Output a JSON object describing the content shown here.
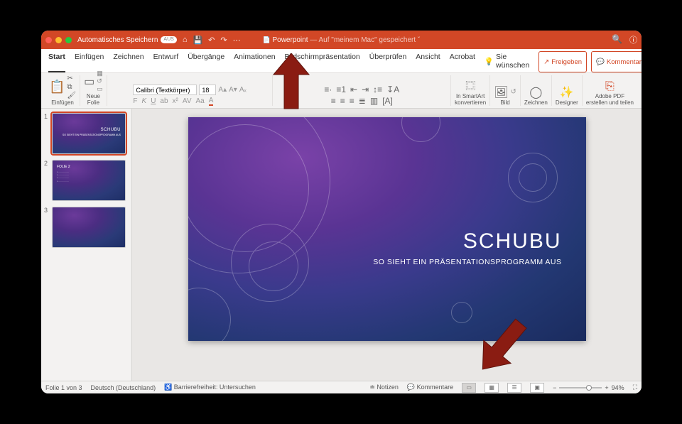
{
  "titlebar": {
    "autosave_label": "Automatisches Speichern",
    "autosave_state": "AUS",
    "filename": "Powerpoint",
    "saved_suffix": " — Auf \"meinem Mac\" gespeichert",
    "chevron": "ˇ"
  },
  "tabs": {
    "items": [
      "Start",
      "Einfügen",
      "Zeichnen",
      "Entwurf",
      "Übergänge",
      "Animationen",
      "Bildschirmpräsentation",
      "Überprüfen",
      "Ansicht",
      "Acrobat"
    ],
    "tellme": "Sie wünschen",
    "share": "Freigeben",
    "comments": "Kommentare",
    "active_index": 0
  },
  "ribbon": {
    "paste": "Einfügen",
    "newslide": "Neue\nFolie",
    "font_name": "Calibri (Textkörper)",
    "font_size": "18",
    "smartart": "In SmartArt\nkonvertieren",
    "picture": "Bild",
    "draw": "Zeichnen",
    "designer": "Designer",
    "pdf": "Adobe PDF\nerstellen und teilen"
  },
  "thumbnails": {
    "items": [
      {
        "num": "1",
        "title": "SCHUBU",
        "sub": "SO SIEHT EIN PRÄSENTATIONSPROGRAMM AUS",
        "selected": true,
        "kind": "title"
      },
      {
        "num": "2",
        "title": "FOLIE 2",
        "selected": false,
        "kind": "content"
      },
      {
        "num": "3",
        "title": "",
        "selected": false,
        "kind": "blank"
      }
    ]
  },
  "slide": {
    "title": "SCHUBU",
    "subtitle": "SO SIEHT EIN PRÄSENTATIONSPROGRAMM AUS"
  },
  "status": {
    "slide_of": "Folie 1 von 3",
    "language": "Deutsch (Deutschland)",
    "a11y": "Barrierefreiheit: Untersuchen",
    "notes": "Notizen",
    "comments": "Kommentare",
    "zoom_pct": "94%"
  }
}
